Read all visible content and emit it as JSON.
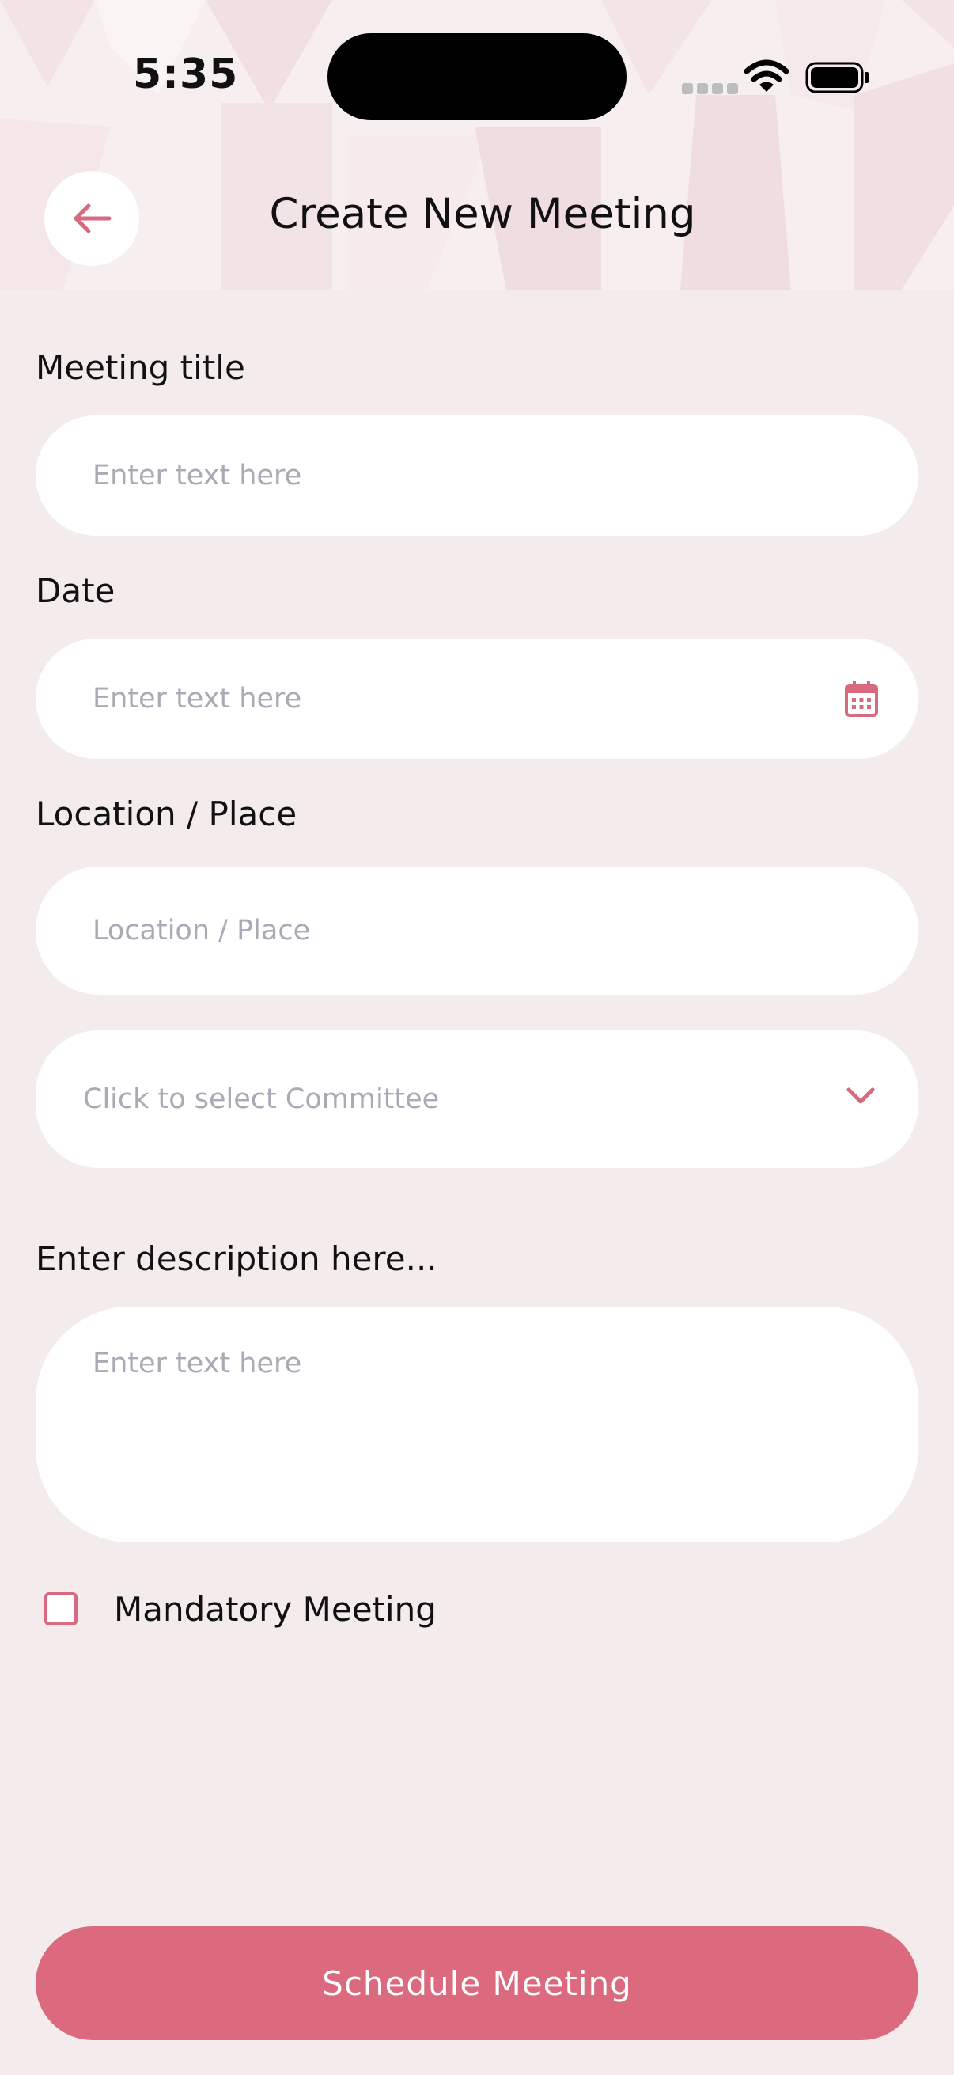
{
  "status_bar": {
    "time": "5:35",
    "icons": [
      "cellular-signal-icon",
      "wifi-icon",
      "battery-icon"
    ]
  },
  "header": {
    "back_icon": "arrow-left-icon",
    "title": "Create New Meeting"
  },
  "form": {
    "meeting_title": {
      "label": "Meeting title",
      "placeholder": "Enter text here",
      "value": ""
    },
    "date": {
      "label": "Date",
      "placeholder": "Enter text here",
      "value": "",
      "icon": "calendar-icon"
    },
    "location": {
      "label": "Location / Place",
      "placeholder": "Location / Place",
      "value": ""
    },
    "committee": {
      "placeholder": "Click to select Committee",
      "icon": "chevron-down-icon"
    },
    "description": {
      "label": "Enter description here...",
      "placeholder": "Enter text here",
      "value": ""
    },
    "mandatory": {
      "label": "Mandatory Meeting",
      "checked": false
    }
  },
  "submit_button": {
    "label": "Schedule Meeting"
  },
  "colors": {
    "accent": "#db6a7f",
    "background": "#f4ecec",
    "field_bg": "#ffffff",
    "placeholder": "#a9aab6",
    "text": "#111111"
  }
}
